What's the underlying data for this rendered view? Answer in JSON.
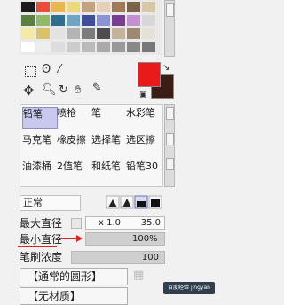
{
  "brushes": {
    "row1": [
      "铅笔",
      "喷枪",
      "笔",
      "水彩笔"
    ],
    "row2": [
      "马克笔",
      "橡皮擦",
      "选择笔",
      "选区擦"
    ],
    "row3": [
      "油漆桶",
      "2值笔",
      "和纸笔",
      "铅笔30"
    ],
    "sizes": [
      "",
      "",
      "",
      "30"
    ]
  },
  "blend_mode": "正常",
  "params": {
    "max_diameter_label": "最大直径",
    "multiplier": "x 1.0",
    "max_diameter_value": "35.0",
    "min_diameter_label": "最小直径",
    "min_diameter_value": "100%",
    "min_diameter_fraction": 1.0,
    "brush_density_label": "笔刷浓度",
    "brush_density_value": "100",
    "shape_dropdown": "【通常的圆形】",
    "texture_dropdown": "【无材质】"
  },
  "colors": {
    "foreground": "#e81a1a",
    "background": "#3a1d14",
    "annotation_arrow": "#e02020"
  },
  "watermark": "百度经验 jingyan"
}
